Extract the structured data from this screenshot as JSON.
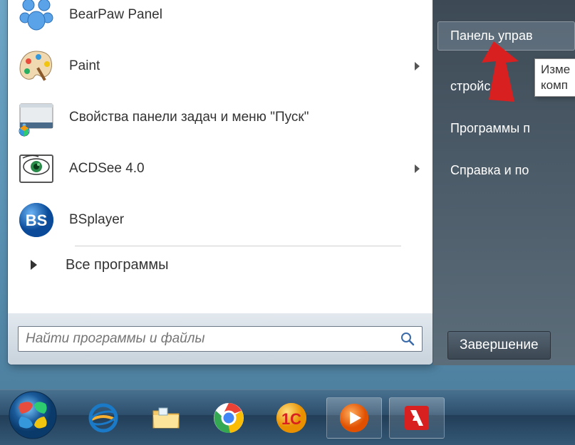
{
  "start_menu": {
    "programs": [
      {
        "label": "BearPaw Panel",
        "icon": "bearpaw",
        "has_submenu": false
      },
      {
        "label": "Paint",
        "icon": "paint",
        "has_submenu": true
      },
      {
        "label": "Свойства панели задач и меню \"Пуск\"",
        "icon": "taskbar-props",
        "has_submenu": false
      },
      {
        "label": "ACDSee 4.0",
        "icon": "acdsee",
        "has_submenu": true
      },
      {
        "label": "BSplayer",
        "icon": "bsplayer",
        "has_submenu": false
      }
    ],
    "all_programs_label": "Все программы",
    "search_placeholder": "Найти программы и файлы"
  },
  "right_panel": {
    "items": [
      {
        "label": "Панель управ",
        "hovered": true
      },
      {
        "label": "стройс",
        "hovered": false
      },
      {
        "label": "Программы п",
        "hovered": false
      },
      {
        "label": "Справка и по",
        "hovered": false
      }
    ],
    "tooltip": "Изме\nкомп",
    "shutdown_label": "Завершение"
  },
  "taskbar": {
    "icons": [
      "ie",
      "explorer",
      "chrome",
      "1c",
      "wmp",
      "adobe"
    ]
  }
}
